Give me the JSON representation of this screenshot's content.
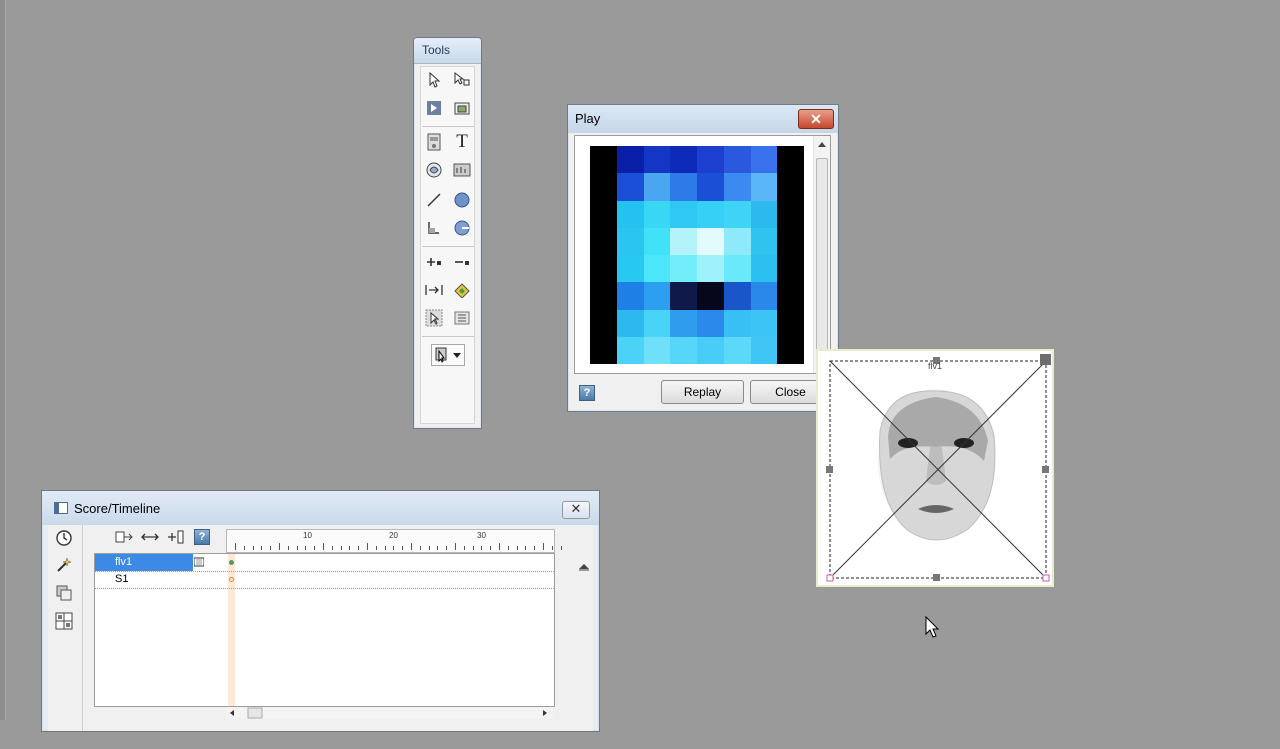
{
  "tools_palette": {
    "title": "Tools",
    "tools": [
      "arrow-tool-icon",
      "rotate-skew-tool-icon",
      "hand-tool-icon",
      "magnify-tool-icon",
      "field-tool-icon",
      "text-tool-icon",
      "button-tool-icon",
      "shape-tool-icon",
      "line-tool-icon",
      "ellipse-tool-icon",
      "rect-tool-icon",
      "round-rect-tool-icon",
      "add-point-tool-icon",
      "remove-point-tool-icon",
      "push-button-tool-icon",
      "paint-bucket-tool-icon",
      "sprite-select-tool-icon",
      "list-tool-icon"
    ],
    "ink_dropdown_icon": "ink-selector-icon"
  },
  "play_dialog": {
    "title": "Play",
    "close_glyph": "✕",
    "replay_label": "Replay",
    "close_label": "Close",
    "help_glyph": "?"
  },
  "sprite": {
    "label": "flv1"
  },
  "score": {
    "title": "Score/Timeline",
    "close_glyph": "✕",
    "ruler_labels": [
      "10",
      "20",
      "30"
    ],
    "tracks": [
      {
        "name": "flv1",
        "selected": true
      },
      {
        "name": "S1",
        "selected": false
      }
    ]
  },
  "colors": {
    "desktop": "#9a9a9a",
    "selection": "#3c8ae6"
  }
}
